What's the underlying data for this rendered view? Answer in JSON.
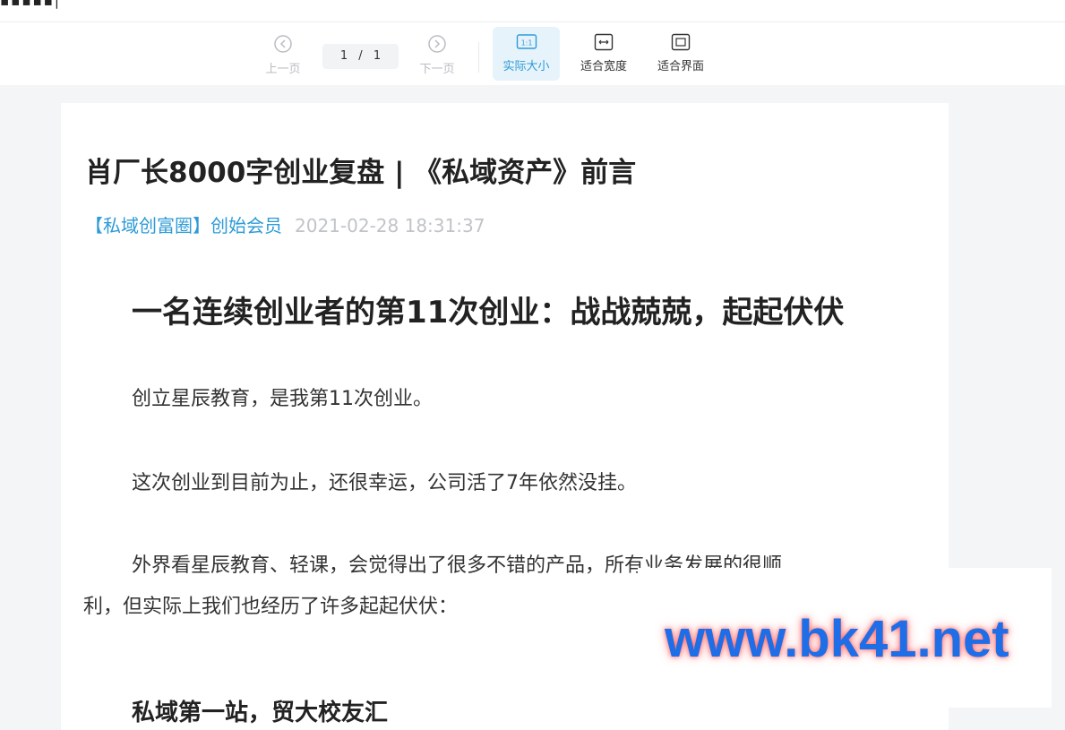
{
  "toolbar": {
    "prev_label": "上一页",
    "next_label": "下一页",
    "page_current": "1",
    "page_separator": "/",
    "page_total": "1",
    "actual_size_icon_text": "1:1",
    "actual_size_label": "实际大小",
    "fit_width_label": "适合宽度",
    "fit_screen_label": "适合界面",
    "icons": [
      "chevron-left-circle-icon",
      "chevron-right-circle-icon",
      "actual-size-icon",
      "fit-width-icon",
      "fit-screen-icon"
    ]
  },
  "article": {
    "title": "肖厂长8000字创业复盘 | 《私域资产》前言",
    "author": "【私域创富圈】创始会员",
    "date": "2021-02-28 18:31:37",
    "heading": "一名连续创业者的第11次创业：战战兢兢，起起伏伏",
    "paragraphs": [
      "创立星辰教育，是我第11次创业。",
      "这次创业到目前为止，还很幸运，公司活了7年依然没挂。",
      "外界看星辰教育、轻课，会觉得出了很多不错的产品，所有业务发展的很顺",
      "利，但实际上我们也经历了许多起起伏伏："
    ],
    "subheading": "私域第一站，贸大校友汇"
  },
  "watermark": "www.bk41.net",
  "colors": {
    "accent": "#2d9bd6",
    "watermark": "#1e6ee8",
    "text": "#333333",
    "disabled": "#b9bcc2"
  }
}
